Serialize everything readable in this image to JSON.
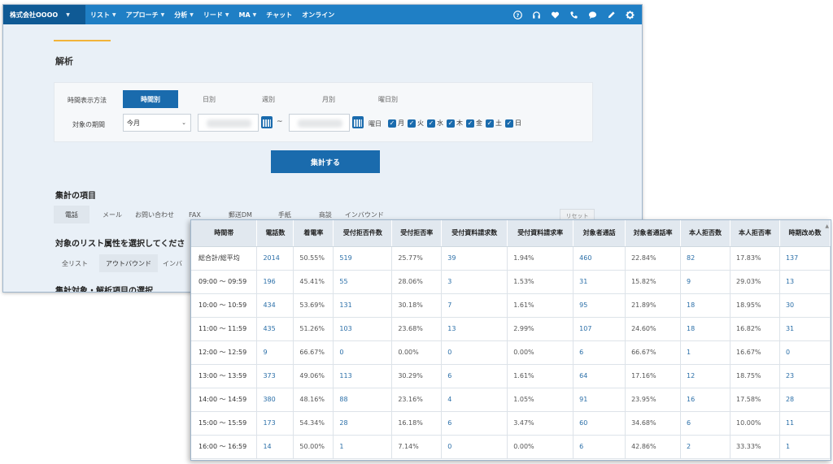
{
  "navbar": {
    "brand": "株式会社OOOO",
    "items": [
      {
        "label": "リスト",
        "has_caret": true
      },
      {
        "label": "アプローチ",
        "has_caret": true
      },
      {
        "label": "分析",
        "has_caret": true
      },
      {
        "label": "リード",
        "has_caret": true
      },
      {
        "label": "MA",
        "has_caret": true
      },
      {
        "label": "チャット",
        "has_caret": false
      },
      {
        "label": "オンライン",
        "has_caret": false
      }
    ],
    "icons": [
      "help-icon",
      "headset-icon",
      "heart-icon",
      "phone-icon",
      "chat-bubble-icon",
      "pencil-icon",
      "gear-icon"
    ]
  },
  "page": {
    "title": "解析"
  },
  "filters": {
    "display_method_label": "時間表示方法",
    "display_methods": [
      {
        "label": "時間別",
        "active": true
      },
      {
        "label": "日別",
        "active": false
      },
      {
        "label": "週別",
        "active": false
      },
      {
        "label": "月別",
        "active": false
      },
      {
        "label": "曜日別",
        "active": false
      }
    ],
    "period_label": "対象の期間",
    "period_value": "今月",
    "tilde": "~",
    "weekday_label": "曜日",
    "weekdays": [
      {
        "label": "月",
        "checked": true
      },
      {
        "label": "火",
        "checked": true
      },
      {
        "label": "水",
        "checked": true
      },
      {
        "label": "木",
        "checked": true
      },
      {
        "label": "金",
        "checked": true
      },
      {
        "label": "土",
        "checked": true
      },
      {
        "label": "日",
        "checked": true
      }
    ]
  },
  "aggregate_button": "集計する",
  "aggregation_items": {
    "title": "集計の項目",
    "tabs": [
      {
        "label": "電話",
        "active": true
      },
      {
        "label": "メール",
        "active": false
      },
      {
        "label": "お問い合わせ",
        "active": false
      },
      {
        "label": "FAX",
        "active": false
      },
      {
        "label": "郵送DM",
        "active": false
      },
      {
        "label": "手紙",
        "active": false
      },
      {
        "label": "商談",
        "active": false
      },
      {
        "label": "インバウンド",
        "active": false
      }
    ],
    "reset_label": "リセット"
  },
  "list_attributes": {
    "title": "対象のリスト属性を選択してくださ",
    "tabs": [
      {
        "label": "全リスト",
        "active": false
      },
      {
        "label": "アウトバウンド",
        "active": true
      },
      {
        "label": "インバ",
        "active": false
      }
    ]
  },
  "target_section": {
    "title": "集計対象・解析項目の選択"
  },
  "table": {
    "headers": [
      "時間帯",
      "電話数",
      "着電率",
      "受付拒否件数",
      "受付拒否率",
      "受付資料請求数",
      "受付資料請求率",
      "対象者通話",
      "対象者通話率",
      "本人拒否数",
      "本人拒否率",
      "時期改め数"
    ],
    "rows": [
      [
        "総合計/総平均",
        "2014",
        "50.55%",
        "519",
        "25.77%",
        "39",
        "1.94%",
        "460",
        "22.84%",
        "82",
        "17.83%",
        "137"
      ],
      [
        "09:00 ～ 09:59",
        "196",
        "45.41%",
        "55",
        "28.06%",
        "3",
        "1.53%",
        "31",
        "15.82%",
        "9",
        "29.03%",
        "13"
      ],
      [
        "10:00 ～ 10:59",
        "434",
        "53.69%",
        "131",
        "30.18%",
        "7",
        "1.61%",
        "95",
        "21.89%",
        "18",
        "18.95%",
        "30"
      ],
      [
        "11:00 ～ 11:59",
        "435",
        "51.26%",
        "103",
        "23.68%",
        "13",
        "2.99%",
        "107",
        "24.60%",
        "18",
        "16.82%",
        "31"
      ],
      [
        "12:00 ～ 12:59",
        "9",
        "66.67%",
        "0",
        "0.00%",
        "0",
        "0.00%",
        "6",
        "66.67%",
        "1",
        "16.67%",
        "0"
      ],
      [
        "13:00 ～ 13:59",
        "373",
        "49.06%",
        "113",
        "30.29%",
        "6",
        "1.61%",
        "64",
        "17.16%",
        "12",
        "18.75%",
        "23"
      ],
      [
        "14:00 ～ 14:59",
        "380",
        "48.16%",
        "88",
        "23.16%",
        "4",
        "1.05%",
        "91",
        "23.95%",
        "16",
        "17.58%",
        "28"
      ],
      [
        "15:00 ～ 15:59",
        "173",
        "54.34%",
        "28",
        "16.18%",
        "6",
        "3.47%",
        "60",
        "34.68%",
        "6",
        "10.00%",
        "11"
      ],
      [
        "16:00 ～ 16:59",
        "14",
        "50.00%",
        "1",
        "7.14%",
        "0",
        "0.00%",
        "6",
        "42.86%",
        "2",
        "33.33%",
        "1"
      ]
    ],
    "link_columns": [
      1,
      3,
      5,
      7,
      9,
      11
    ]
  }
}
